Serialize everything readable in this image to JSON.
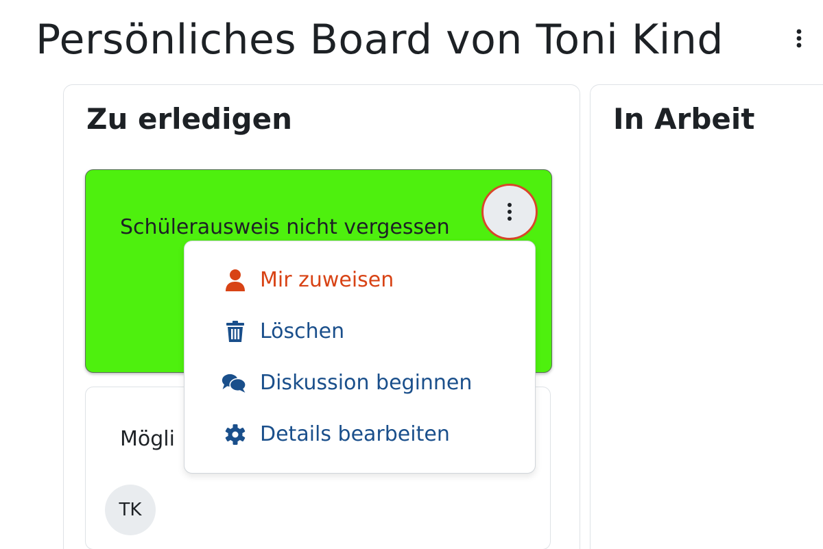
{
  "board": {
    "title": "Persönliches Board von Toni Kind"
  },
  "columns": [
    {
      "title": "Zu erledigen"
    },
    {
      "title": "In Arbeit"
    }
  ],
  "cards": [
    {
      "text": "Schülerausweis nicht vergessen",
      "color": "#4ef00e"
    },
    {
      "text": "Mögli",
      "assignee_initials": "TK"
    }
  ],
  "context_menu": {
    "items": [
      {
        "label": "Mir zuweisen",
        "icon": "user-icon",
        "color": "#d84315"
      },
      {
        "label": "Löschen",
        "icon": "trash-icon",
        "color": "#1a4f8b"
      },
      {
        "label": "Diskussion beginnen",
        "icon": "comments-icon",
        "color": "#1a4f8b"
      },
      {
        "label": "Details bearbeiten",
        "icon": "gear-icon",
        "color": "#1a4f8b"
      }
    ]
  },
  "colors": {
    "accent_orange": "#d84315",
    "accent_blue": "#1a4f8b",
    "card_green": "#4ef00e"
  }
}
